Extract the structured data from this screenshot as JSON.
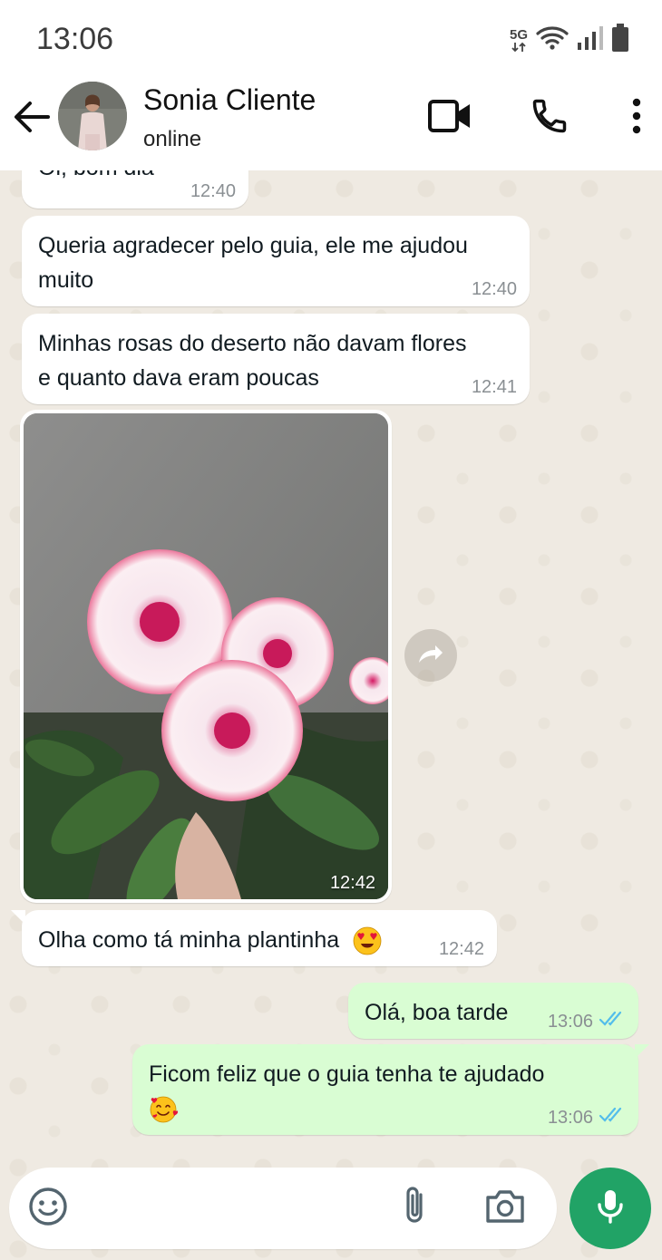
{
  "status_bar": {
    "time": "13:06",
    "network": "5G",
    "icons": [
      "network-5g-icon",
      "wifi-icon",
      "signal-icon",
      "battery-icon"
    ]
  },
  "header": {
    "contact_name": "Sonia Cliente",
    "contact_status": "online",
    "icons": [
      "back-arrow-icon",
      "video-call-icon",
      "phone-icon",
      "more-options-icon"
    ]
  },
  "messages": [
    {
      "direction": "in",
      "text": "Oi, bom dia",
      "time": "12:40"
    },
    {
      "direction": "in",
      "text": "Queria agradecer pelo guia, ele me ajudou muito",
      "time": "12:40"
    },
    {
      "direction": "in",
      "text": "Minhas rosas do deserto não davam flores e quanto dava eram poucas",
      "time": "12:41"
    },
    {
      "direction": "in",
      "type": "image",
      "time": "12:42"
    },
    {
      "direction": "in",
      "text": "Olha como tá minha plantinha",
      "emoji": "heart-eyes-emoji",
      "time": "12:42"
    },
    {
      "direction": "out",
      "text": "Olá, boa tarde",
      "time": "13:06",
      "status": "read"
    },
    {
      "direction": "out",
      "text": "Ficom feliz que o guia tenha te ajudado",
      "emoji": "smiling-face-with-hearts-emoji",
      "time": "13:06",
      "status": "read"
    }
  ],
  "input": {
    "placeholder": "",
    "icons": [
      "emoji-icon",
      "attach-icon",
      "camera-icon",
      "mic-icon"
    ]
  },
  "colors": {
    "chat_background": "#efeae2",
    "incoming_bubble": "#ffffff",
    "outgoing_bubble": "#d9fdd3",
    "read_ticks": "#53bdeb",
    "accent": "#21a366"
  }
}
